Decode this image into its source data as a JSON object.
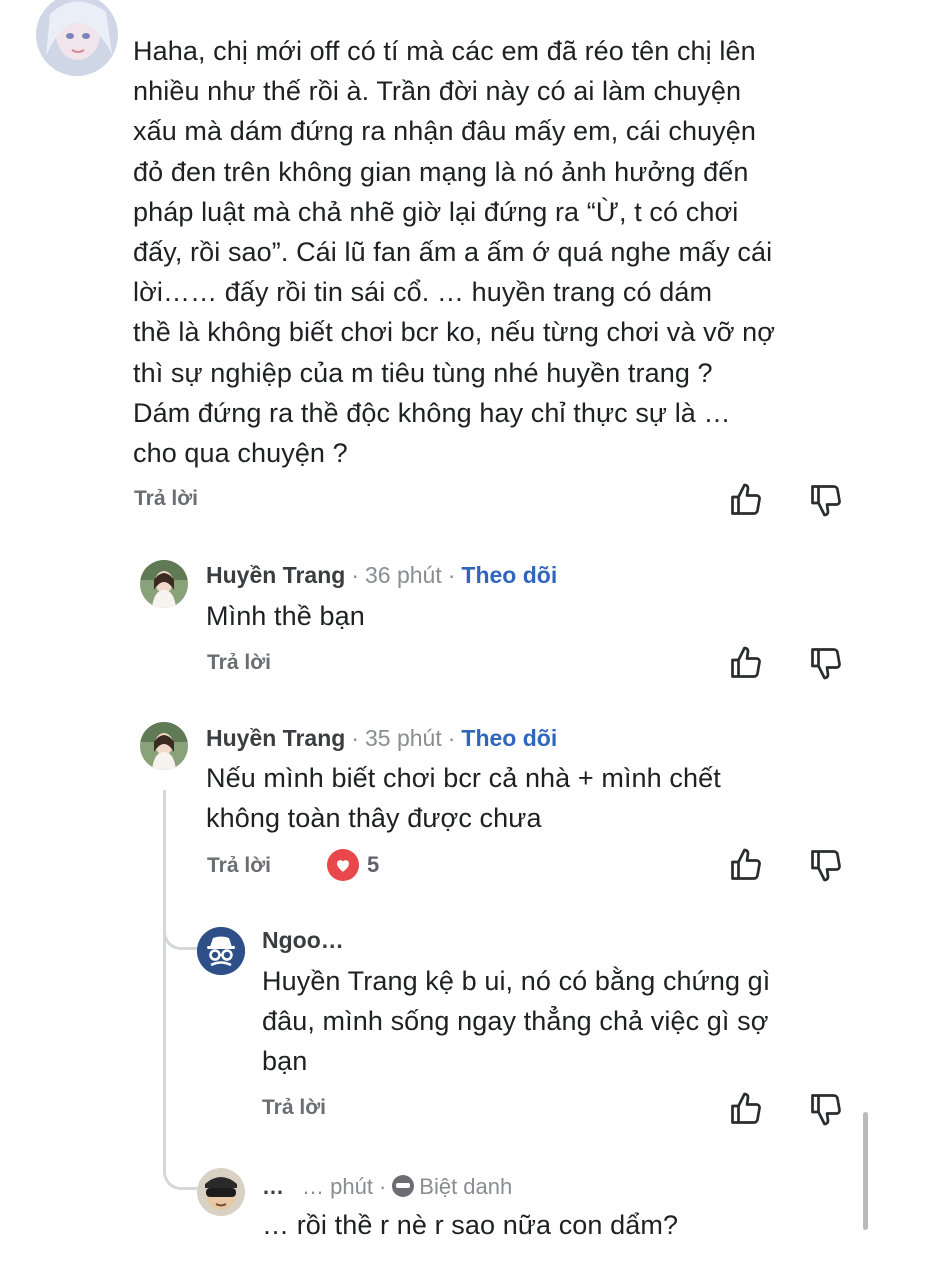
{
  "top_comment": {
    "lines": [
      "Haha, chị mới off có tí mà các em đã réo tên chị lên",
      "nhiều như thế rồi à. Trần đời này có ai làm chuyện",
      "xấu mà dám đứng ra nhận đâu mấy em, cái chuyện",
      "đỏ đen trên không gian mạng là nó ảnh hưởng đến",
      "pháp luật mà chả nhẽ giờ lại đứng ra “Ừ, t có chơi",
      "đấy, rồi sao”. Cái lũ fan ấm a ấm ớ quá nghe mấy cái",
      "lời……  đấy rồi tin sái cổ. … huyền trang có dám",
      "thề là không biết chơi bcr ko, nếu từng chơi và vỡ nợ",
      "thì sự nghiệp của m tiêu tùng nhé huyền trang ?",
      "Dám đứng ra thề độc không hay chỉ thực sự là …",
      "cho qua chuyện ?"
    ],
    "reply_label": "Trả lời"
  },
  "replies": [
    {
      "author": "Huyền Trang",
      "time": "36 phút",
      "follow": "Theo dõi",
      "lines": [
        "Mình thề bạn"
      ],
      "reply_label": "Trả lời"
    },
    {
      "author": "Huyền Trang",
      "time": "35 phút",
      "follow": "Theo dõi",
      "lines": [
        "Nếu mình biết chơi bcr cả nhà + mình chết",
        "không toàn thây được chưa"
      ],
      "reply_label": "Trả lời",
      "reaction_count": "5"
    }
  ],
  "nested": [
    {
      "author": "Ngoo…",
      "lines": [
        "Huyền Trang kệ b ui, nó có bằng chứng gì",
        "đâu, mình sống ngay thẳng chả việc gì sợ",
        "bạn"
      ],
      "reply_label": "Trả lời"
    },
    {
      "author": "…",
      "time": "… phút",
      "nickname": "Biệt danh",
      "lines": [
        "… rồi thề r nè r sao nữa con dẩm?"
      ]
    }
  ],
  "separators": {
    "dot": "·"
  },
  "colors": {
    "link": "#3066be",
    "heart": "#e8484c",
    "text": "#1f2023"
  }
}
